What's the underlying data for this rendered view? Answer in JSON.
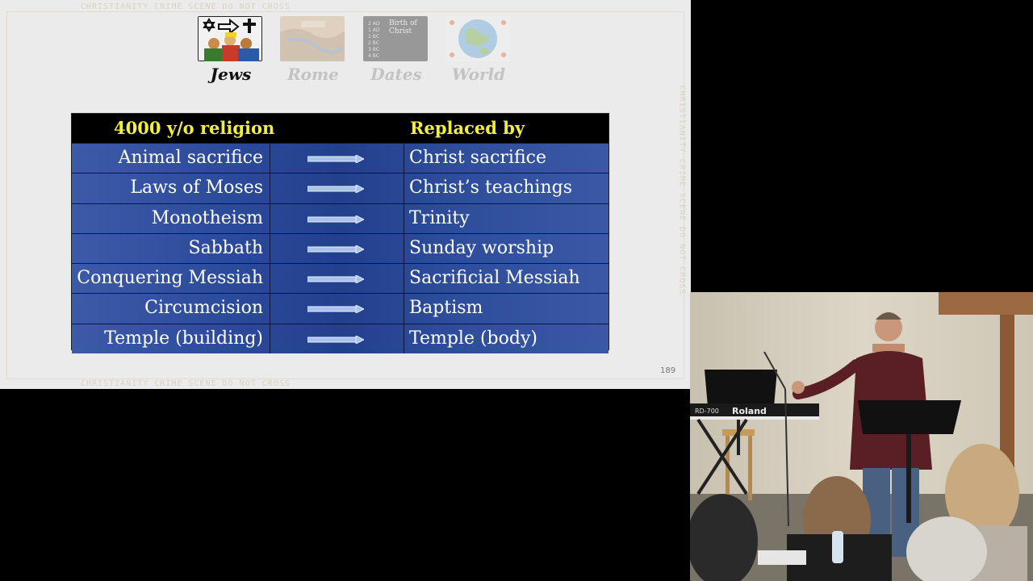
{
  "slide": {
    "tape_text": "CHRISTIANITY CRIME SCENE DO NOT CROSS",
    "page_number": "189",
    "puzzle": [
      {
        "label": "Jews",
        "active": true
      },
      {
        "label": "Rome",
        "active": false
      },
      {
        "label": "Dates",
        "active": false
      },
      {
        "label": "World",
        "active": false
      }
    ],
    "dates_piece": {
      "title_line1": "Birth of",
      "title_line2": "Christ",
      "list": [
        "2 AD",
        "1 AD",
        "1 BC",
        "2 BC",
        "3 BC",
        "4 BC"
      ]
    },
    "table": {
      "header_left": "4000 y/o religion",
      "header_right": "Replaced by",
      "rows": [
        {
          "left": "Animal sacrifice",
          "right": "Christ sacrifice"
        },
        {
          "left": "Laws of Moses",
          "right": "Christ’s teachings"
        },
        {
          "left": "Monotheism",
          "right": "Trinity"
        },
        {
          "left": "Sabbath",
          "right": "Sunday worship"
        },
        {
          "left": "Conquering Messiah",
          "right": "Sacrificial Messiah"
        },
        {
          "left": "Circumcision",
          "right": "Baptism"
        },
        {
          "left": "Temple (building)",
          "right": "Temple (body)"
        }
      ]
    }
  },
  "camera": {
    "keyboard_model": "RD-700",
    "keyboard_brand": "Roland"
  }
}
